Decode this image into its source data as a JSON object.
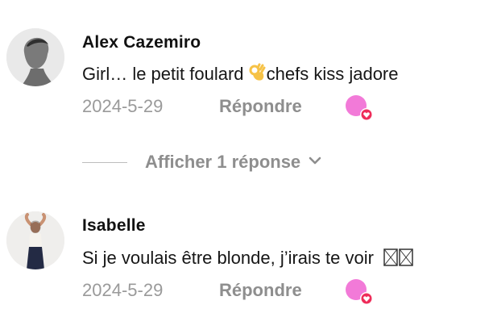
{
  "comments": [
    {
      "author": "Alex Cazemiro",
      "text_before": "Girl… le petit foulard ",
      "text_after": "chefs kiss jadore",
      "emoji_icon": "ok-hand-icon",
      "date": "2024-5-29",
      "reply_label": "Répondre",
      "like_icon": "heart-badge-icon"
    },
    {
      "author": "Isabelle",
      "text": "Si je voulais être blonde, j’irais te voir",
      "date": "2024-5-29",
      "reply_label": "Répondre",
      "like_icon": "heart-badge-icon"
    }
  ],
  "replies_toggle": {
    "label": "Afficher 1 réponse",
    "icon": "chevron-down-icon"
  },
  "colors": {
    "like_pink": "#f27ad8",
    "badge_red": "#ee2c59",
    "muted_text": "#8e8e8e"
  }
}
